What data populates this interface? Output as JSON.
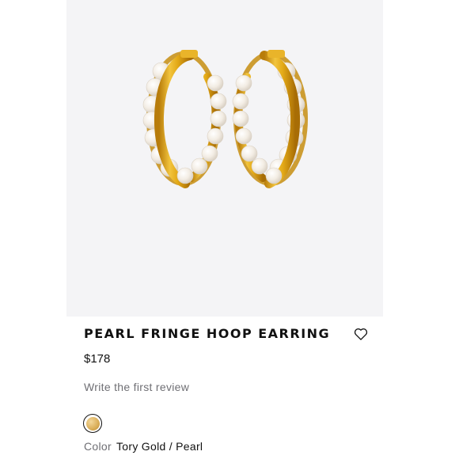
{
  "product": {
    "title": "PEARL FRINGE HOOP EARRING",
    "price": "$178",
    "review_link": "Write the first review",
    "color_label": "Color",
    "color_value": "Tory Gold / Pearl"
  },
  "gallery": {
    "image_count": 3,
    "active_index": 0
  },
  "icons": {
    "wishlist": "heart-outline-icon",
    "swatch": "gold-swatch"
  },
  "colors": {
    "gallery_bg": "#f4f4f6",
    "gold": "#e0a91c",
    "pearl": "#f6f1ea",
    "text": "#111111",
    "muted": "#6f6f74"
  }
}
